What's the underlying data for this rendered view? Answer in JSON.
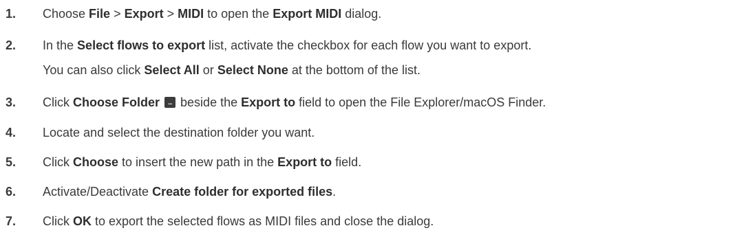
{
  "steps": [
    {
      "num": "1.",
      "parts": [
        "Choose ",
        "File",
        " > ",
        "Export",
        " > ",
        "MIDI",
        " to open the ",
        "Export MIDI",
        " dialog."
      ]
    },
    {
      "num": "2.",
      "line1": [
        "In the ",
        "Select flows to export",
        " list, activate the checkbox for each flow you want to export."
      ],
      "line2": [
        "You can also click ",
        "Select All",
        " or ",
        "Select None",
        " at the bottom of the list."
      ]
    },
    {
      "num": "3.",
      "parts": [
        "Click ",
        "Choose Folder",
        " beside the ",
        "Export to",
        " field to open the File Explorer/macOS Finder."
      ],
      "icon": "ellipsis-folder-icon"
    },
    {
      "num": "4.",
      "parts": [
        "Locate and select the destination folder you want."
      ]
    },
    {
      "num": "5.",
      "parts": [
        "Click ",
        "Choose",
        " to insert the new path in the ",
        "Export to",
        " field."
      ]
    },
    {
      "num": "6.",
      "parts": [
        "Activate/Deactivate ",
        "Create folder for exported files",
        "."
      ]
    },
    {
      "num": "7.",
      "parts": [
        "Click ",
        "OK",
        " to export the selected flows as MIDI files and close the dialog."
      ]
    }
  ]
}
